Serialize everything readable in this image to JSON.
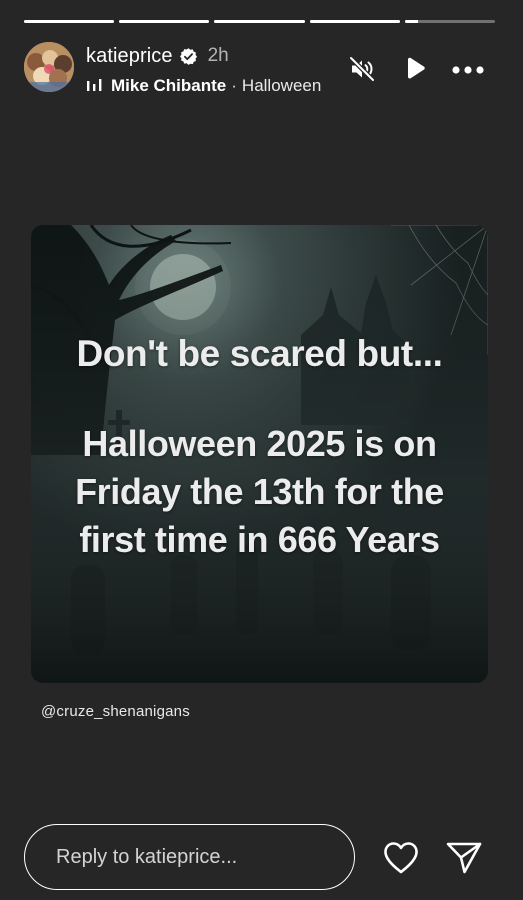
{
  "progress": [
    {
      "fraction": 1
    },
    {
      "fraction": 1
    },
    {
      "fraction": 1
    },
    {
      "fraction": 1
    },
    {
      "fraction": 0.15
    }
  ],
  "header": {
    "username": "katieprice",
    "verified_icon": "verified-badge-icon",
    "time": "2h",
    "music_icon": "music-bars-icon",
    "artist": "Mike Chibante",
    "separator": "·",
    "song": "Halloween"
  },
  "controls": {
    "mute_icon": "muted-speaker-icon",
    "play_icon": "play-icon",
    "more_icon": "more-dots-icon"
  },
  "story": {
    "headline": "Don't be scared but...",
    "body": "Halloween 2025 is on Friday the 13th for the first time in 666 Years",
    "mention": "@cruze_shenanigans"
  },
  "reply": {
    "placeholder": "Reply to katieprice...",
    "like_icon": "heart-icon",
    "send_icon": "send-icon"
  },
  "colors": {
    "background": "#262626",
    "text": "#ffffff"
  }
}
